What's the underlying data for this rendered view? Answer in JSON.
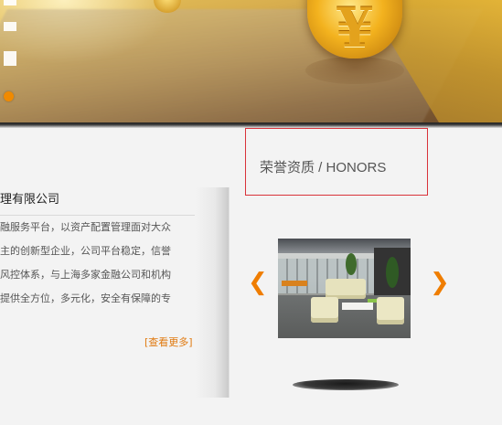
{
  "about": {
    "title": "理有限公司",
    "lines": [
      "融服务平台，以资产配置管理面对大众",
      "主的创新型企业，公司平台稳定，信誉",
      "风控体系，与上海多家金融公司和机构",
      "提供全方位，多元化，安全有保障的专"
    ],
    "more_label": "[查看更多]"
  },
  "honors": {
    "title": "荣誉资质 / HONORS",
    "prev_glyph": "❮",
    "next_glyph": "❯"
  },
  "colors": {
    "accent": "#ef7d00",
    "honors_border": "#d9323a",
    "link": "#e07a10"
  },
  "icons": {
    "slide_prev": "chevron-left-icon",
    "slide_next": "chevron-right-icon",
    "banner_coin": "yen-coin-icon"
  }
}
